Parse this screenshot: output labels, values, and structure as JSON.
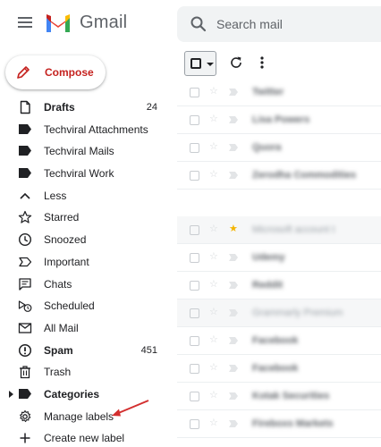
{
  "header": {
    "app_name": "Gmail",
    "search_placeholder": "Search mail"
  },
  "compose": {
    "label": "Compose"
  },
  "sidebar": {
    "items": [
      {
        "label": "Drafts",
        "count": "24",
        "icon": "draft-icon",
        "bold": true
      },
      {
        "label": "Techviral Attachments",
        "icon": "label-icon"
      },
      {
        "label": "Techviral Mails",
        "icon": "label-icon"
      },
      {
        "label": "Techviral Work",
        "icon": "label-icon"
      },
      {
        "label": "Less",
        "icon": "chevron-up-icon"
      },
      {
        "label": "Starred",
        "icon": "star-icon"
      },
      {
        "label": "Snoozed",
        "icon": "clock-icon"
      },
      {
        "label": "Important",
        "icon": "important-icon"
      },
      {
        "label": "Chats",
        "icon": "chat-icon"
      },
      {
        "label": "Scheduled",
        "icon": "scheduled-icon"
      },
      {
        "label": "All Mail",
        "icon": "mail-icon"
      },
      {
        "label": "Spam",
        "count": "451",
        "icon": "spam-icon",
        "bold": true
      },
      {
        "label": "Trash",
        "icon": "trash-icon"
      },
      {
        "label": "Categories",
        "icon": "label-icon",
        "bold": true
      },
      {
        "label": "Manage labels",
        "icon": "gear-icon"
      },
      {
        "label": "Create new label",
        "icon": "plus-icon"
      }
    ]
  },
  "emails": {
    "group1": [
      {
        "sender": "Twitter"
      },
      {
        "sender": "Lisa Powers"
      },
      {
        "sender": "Quora"
      },
      {
        "sender": "Zerodha Commodities"
      }
    ],
    "group2": [
      {
        "sender": "Microsoft account t",
        "read": true,
        "starred": true
      },
      {
        "sender": "Udemy"
      },
      {
        "sender": "Reddit"
      },
      {
        "sender": "Grammarly Premium",
        "read": true
      },
      {
        "sender": "Facebook"
      },
      {
        "sender": "Facebook"
      },
      {
        "sender": "Kotak Securities"
      },
      {
        "sender": "Fireboxs Markets"
      }
    ]
  },
  "colors": {
    "accent": "#c5221f",
    "annotation_arrow": "#d32f2f"
  }
}
